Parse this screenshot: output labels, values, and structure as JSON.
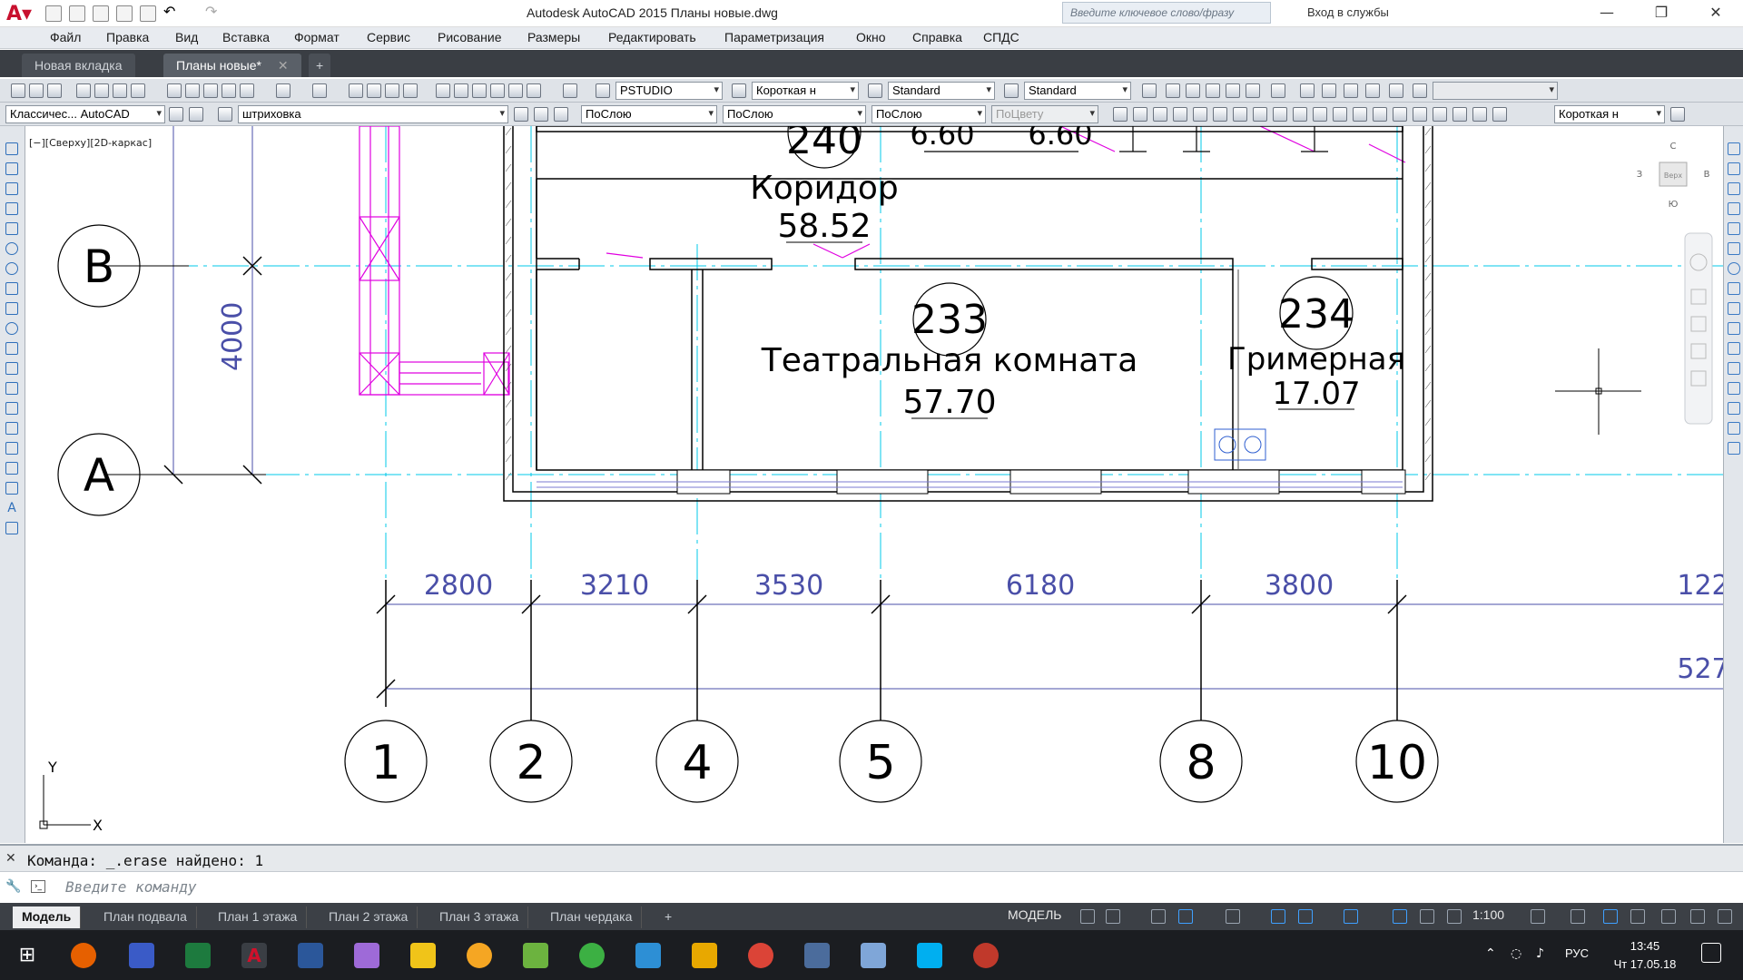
{
  "window": {
    "title": "Autodesk AutoCAD 2015    Планы новые.dwg",
    "search_placeholder": "Введите ключевое слово/фразу",
    "signin_label": "Вход в службы",
    "minimize": "—",
    "restore": "❐",
    "close": "✕"
  },
  "menu": [
    "Файл",
    "Правка",
    "Вид",
    "Вставка",
    "Формат",
    "Сервис",
    "Рисование",
    "Размеры",
    "Редактировать",
    "Параметризация",
    "Окно",
    "Справка",
    "СПДС"
  ],
  "doc_tabs": [
    {
      "label": "Новая вкладка",
      "active": false
    },
    {
      "label": "Планы новые*",
      "active": true
    }
  ],
  "toolbar1": {
    "textstyle": "PSTUDIO",
    "dimstyle": "Короткая н",
    "tablestyle": "Standard",
    "mleaderstyle": "Standard"
  },
  "toolbar2": {
    "workspace": "Классичес... AutoCAD",
    "layer": "штриховка",
    "color": "ПоСлою",
    "linetype": "ПоСлою",
    "lineweight": "ПоСлою",
    "plotstyle": "ПоЦвету",
    "dimstyle2": "Короткая н"
  },
  "viewport_label": "[−][Сверху][2D-каркас]",
  "viewcube": {
    "north": "С",
    "south": "Ю",
    "west": "З",
    "east": "В",
    "top": "Верх"
  },
  "rooms": [
    {
      "number": "240",
      "name": "Коридор",
      "area": "58.52"
    },
    {
      "number": "233",
      "name": "Театральная комната",
      "area": "57.70"
    },
    {
      "number": "234",
      "name": "Гримерная",
      "area": "17.07"
    }
  ],
  "partial_areas": [
    "6.60",
    "6.60"
  ],
  "grid_axes_letters": [
    "В",
    "А"
  ],
  "grid_axes_numbers": [
    "1",
    "2",
    "4",
    "5",
    "8",
    "10"
  ],
  "dim_vertical": "4000",
  "dims_horizontal": [
    "2800",
    "3210",
    "3530",
    "6180",
    "3800",
    "122"
  ],
  "dim_total": "527",
  "ucs": {
    "y": "Y",
    "x": "X"
  },
  "command": {
    "history": "Команда: _.erase найдено: 1",
    "placeholder": "Введите команду"
  },
  "layout_tabs": [
    {
      "label": "Модель",
      "active": true
    },
    {
      "label": "План подвала",
      "active": false
    },
    {
      "label": "План 1 этажа",
      "active": false
    },
    {
      "label": "План 2 этажа",
      "active": false
    },
    {
      "label": "План 3 этажа",
      "active": false
    },
    {
      "label": "План чердака",
      "active": false
    }
  ],
  "status": {
    "model": "МОДЕЛЬ",
    "scale": "1:100"
  },
  "taskbar": {
    "lang": "РУС",
    "time": "13:45",
    "date": "Чт 17.05.18"
  },
  "colors": {
    "axis": "#00c8e8",
    "dim": "#4a4fa8",
    "hatch": "#e000e0",
    "wall": "#000000"
  }
}
